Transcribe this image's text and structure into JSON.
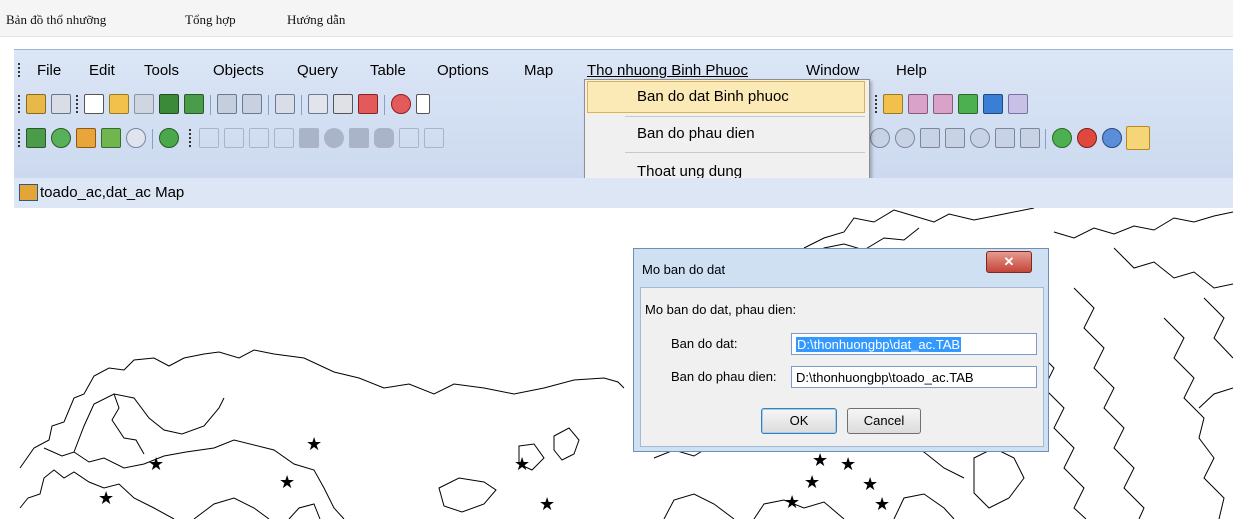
{
  "top_menu": {
    "items": [
      "Bản đồ thổ nhưỡng",
      "Tổng hợp",
      "Hướng dẫn"
    ]
  },
  "menubar": {
    "items": [
      "File",
      "Edit",
      "Tools",
      "Objects",
      "Query",
      "Table",
      "Options",
      "Map",
      "Tho nhuong Binh Phuoc",
      "Window",
      "Help"
    ]
  },
  "dropdown": {
    "items": [
      "Ban do dat Binh phuoc",
      "Ban do phau dien",
      "Thoat ung dung"
    ]
  },
  "map_window": {
    "title": "toado_ac,dat_ac Map"
  },
  "dialog": {
    "title": "Mo ban do dat",
    "prompt": "Mo ban do dat, phau dien:",
    "dat_label": "Ban do dat:",
    "dat_value": "D:\\thonhuongbp\\dat_ac.TAB",
    "phau_label": "Ban do phau dien:",
    "phau_value": "D:\\thonhuongbp\\toado_ac.TAB",
    "ok_label": "OK",
    "cancel_label": "Cancel"
  },
  "icons": {
    "toolbar1": [
      "open-table-icon",
      "open-workspace-icon",
      "new-icon",
      "open-icon",
      "close-icon",
      "map-icon",
      "graph-icon",
      "save-icon",
      "save-as-icon",
      "new-window-icon",
      "layout-icon",
      "print-icon",
      "print-preview-icon",
      "cut-icon",
      "copy-icon"
    ],
    "toolbar1_right": [
      "table-icon",
      "legend-icon",
      "graph2-icon",
      "browser-icon",
      "redistrict-icon",
      "clear-icon"
    ],
    "toolbar2": [
      "layer-control-icon",
      "globe-icon",
      "theme-icon",
      "chart-icon",
      "target-icon",
      "web-icon"
    ],
    "drawing": [
      "symbol-icon",
      "line-icon",
      "polyline-icon",
      "arc-icon",
      "polygon-icon",
      "ellipse-icon",
      "rectangle-icon",
      "rounded-rect-icon",
      "text-icon",
      "frame-icon"
    ],
    "toolbar2_right": [
      "select-icon",
      "radius-select-icon",
      "polygon-select-icon",
      "boundary-select-icon",
      "marquee-select-icon",
      "info-icon",
      "zoom-in-icon",
      "zoom-out-icon",
      "change-view-icon",
      "grabber-icon"
    ]
  }
}
